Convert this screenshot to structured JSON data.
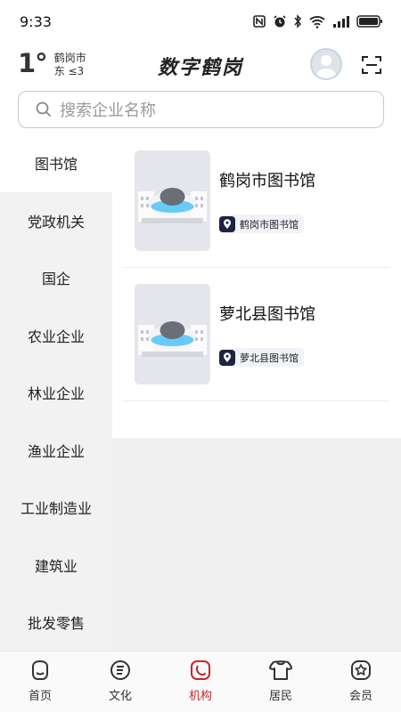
{
  "status_bar": {
    "time": "9:33"
  },
  "header": {
    "temperature": "1°",
    "city": "鹤岗市",
    "wind": "东 ≤3",
    "title": "数字鹤岗"
  },
  "search": {
    "placeholder": "搜索企业名称"
  },
  "sidebar": {
    "items": [
      {
        "label": "图书馆",
        "active": true
      },
      {
        "label": "党政机关"
      },
      {
        "label": "国企"
      },
      {
        "label": "农业企业"
      },
      {
        "label": "林业企业"
      },
      {
        "label": "渔业企业"
      },
      {
        "label": "工业制造业"
      },
      {
        "label": "建筑业"
      },
      {
        "label": "批发零售"
      }
    ]
  },
  "results": [
    {
      "name": "鹤岗市图书馆",
      "tag": "鹤岗市图书馆"
    },
    {
      "name": "萝北县图书馆",
      "tag": "萝北县图书馆"
    }
  ],
  "bottom_nav": {
    "items": [
      {
        "label": "首页",
        "icon": "home-face-icon"
      },
      {
        "label": "文化",
        "icon": "culture-icon"
      },
      {
        "label": "机构",
        "icon": "institution-icon",
        "active": true
      },
      {
        "label": "居民",
        "icon": "resident-icon"
      },
      {
        "label": "会员",
        "icon": "member-icon"
      }
    ]
  },
  "colors": {
    "accent": "#c8262c",
    "sidebar_bg": "#f2f2f2",
    "tag_icon_bg": "#1e2440"
  }
}
